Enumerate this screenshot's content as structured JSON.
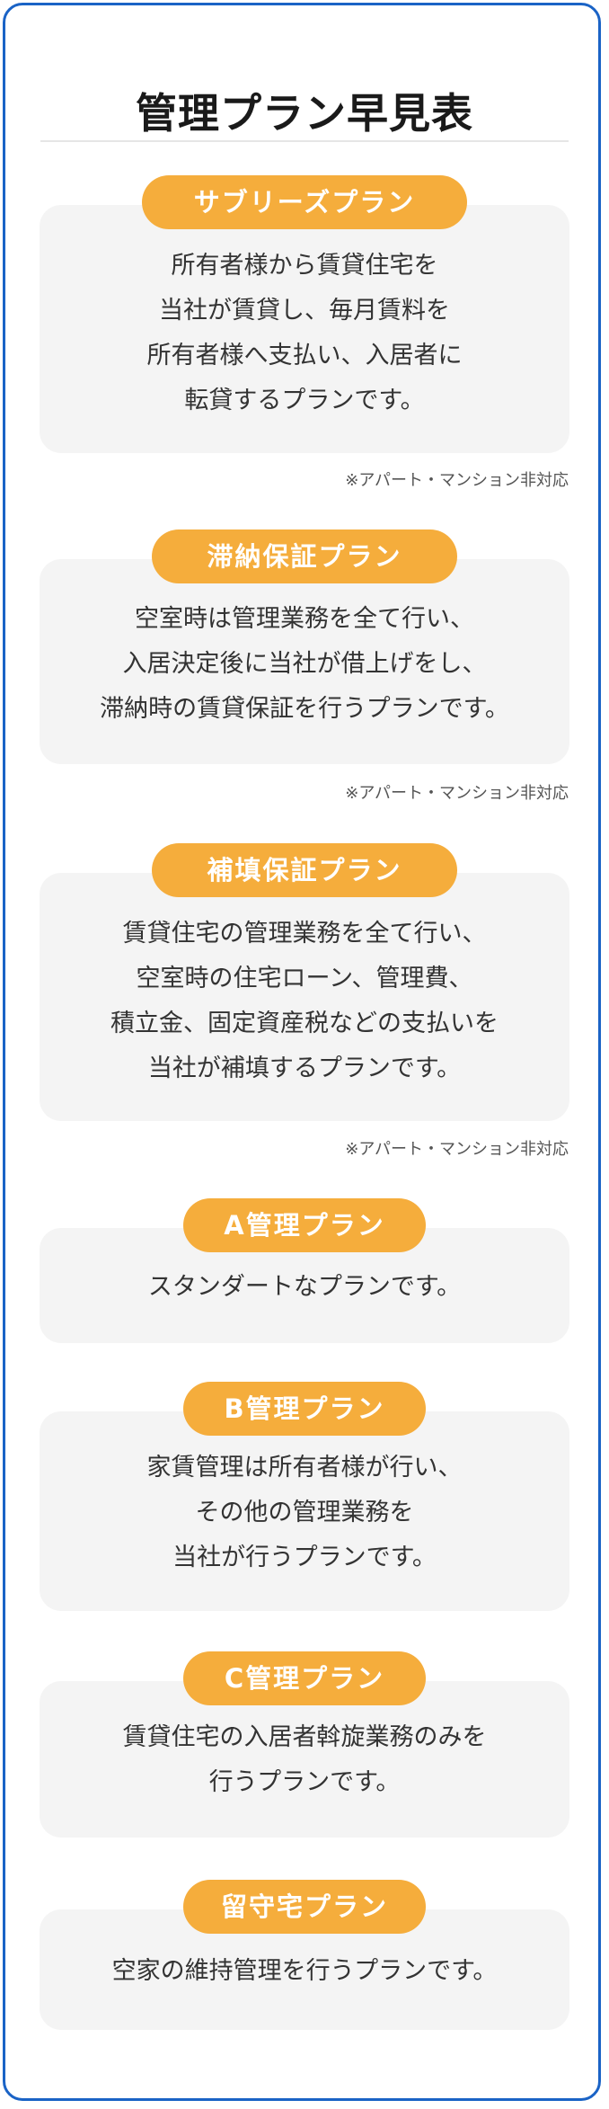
{
  "page": {
    "title": "管理プラン早見表",
    "border_color": "#1a63c6",
    "accent_color": "#f5ad3c",
    "card_color": "#f4f4f4"
  },
  "plans": [
    {
      "name": "サブリーズプラン",
      "lines": [
        "所有者様から賃貸住宅を",
        "当社が賃貸し、毎月賃料を",
        "所有者様へ支払い、入居者に",
        "転貸するプランです。"
      ],
      "note": "※アパート・マンション非対応"
    },
    {
      "name": "滞納保証プラン",
      "lines": [
        "空室時は管理業務を全て行い、",
        "入居決定後に当社が借上げをし、",
        "滞納時の賃貸保証を行うプランです。"
      ],
      "note": "※アパート・マンション非対応"
    },
    {
      "name": "補填保証プラン",
      "lines": [
        "賃貸住宅の管理業務を全て行い、",
        "空室時の住宅ローン、管理費、",
        "積立金、固定資産税などの支払いを",
        "当社が補填するプランです。"
      ],
      "note": "※アパート・マンション非対応"
    },
    {
      "name": "A管理プラン",
      "lines": [
        "スタンダートなプランです。"
      ]
    },
    {
      "name": "B管理プラン",
      "lines": [
        "家賃管理は所有者様が行い、",
        "その他の管理業務を",
        "当社が行うプランです。"
      ]
    },
    {
      "name": "C管理プラン",
      "lines": [
        "賃貸住宅の入居者斡旋業務のみを",
        "行うプランです。"
      ]
    },
    {
      "name": "留守宅プラン",
      "lines": [
        "空家の維持管理を行うプランです。"
      ]
    }
  ]
}
